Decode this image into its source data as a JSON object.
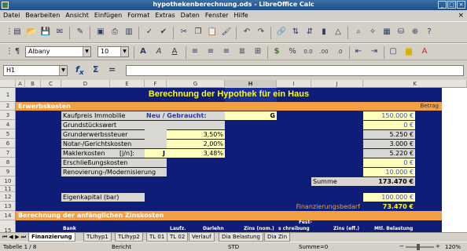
{
  "window": {
    "title": "hypothekenberechnung.ods - LibreOffice Calc"
  },
  "menu": [
    "Datei",
    "Bearbeiten",
    "Ansicht",
    "Einfügen",
    "Format",
    "Extras",
    "Daten",
    "Fenster",
    "Hilfe"
  ],
  "formatting": {
    "font_name": "Albany",
    "font_size": "10"
  },
  "formula_bar": {
    "cell_ref": "H1",
    "content": ""
  },
  "columns": [
    "A",
    "B",
    "C",
    "D",
    "E",
    "F",
    "G",
    "H",
    "I",
    "J",
    "K"
  ],
  "rows": [
    "1",
    "2",
    "3",
    "4",
    "5",
    "6",
    "7",
    "8",
    "9",
    "10",
    "11",
    "12",
    "13",
    "14",
    "15"
  ],
  "sheet": {
    "title": "Berechnung der Hypothek für ein Haus",
    "section1": "Erwerbskosten",
    "betrag": "Betrag",
    "labels": [
      "Kaufpreis Immobilie",
      "Grundstückswert",
      "Grunderwerbssteuer",
      "Notar-/Gerichtskosten",
      "Maklerkosten",
      "Erschließungskosten",
      "Renovierung-/Modernisierung"
    ],
    "maklerkosten_unit": "[j/n]:",
    "maklerkosten_flag": "J",
    "neu_gebraucht_label": "Neu / Gebraucht:",
    "neu_gebraucht_value": "G",
    "percents": [
      "3,50%",
      "2,00%",
      "3,48%"
    ],
    "amounts": [
      "150.000 €",
      "0 €",
      "5.250 €",
      "3.000 €",
      "5.220 €",
      "0 €",
      "10.000 €"
    ],
    "summe_label": "Summe",
    "summe_value": "173.470 €",
    "eigenkapital_label": "Eigenkapital (bar)",
    "eigenkapital_value": "100.000 €",
    "finanzierung_label": "Finanzierungsbedarf",
    "finanzierung_value": "73.470 €",
    "section2": "Berechnung der anfänglichen Zinskosten",
    "table_headers": [
      "Bank",
      "Laufz.",
      "Darlehn",
      "Zins (nom.)",
      "s chreibung",
      "Fest-",
      "Zins (eff.)",
      "Mtl. Belastung"
    ]
  },
  "tabs": [
    "Finanzierung",
    "TLIhyp1",
    "TLIhyp2",
    "TL 01",
    "TL 02",
    "Verlauf",
    "Dia Belastung",
    "Dia Zin"
  ],
  "status": {
    "sheet": "Tabelle 1 / 8",
    "style": "Bericht",
    "mode": "STD",
    "sum": "Summe=0",
    "zoom": "120%"
  },
  "colors": {
    "sheet_background": "#0e1e78",
    "accent_band": "#f3a042",
    "title_text": "#ffff00",
    "input_cells": "#ffffbd"
  }
}
